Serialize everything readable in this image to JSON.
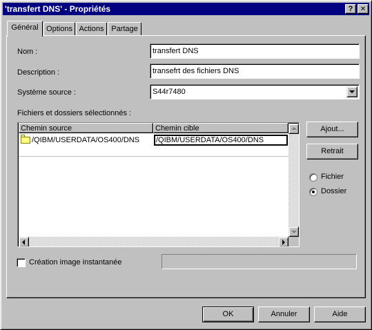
{
  "window": {
    "title": "'transfert DNS' - Propriétés",
    "help_glyph": "?",
    "close_glyph": "✕"
  },
  "tabs": [
    {
      "label": "Général",
      "active": true
    },
    {
      "label": "Options",
      "active": false
    },
    {
      "label": "Actions",
      "active": false
    },
    {
      "label": "Partage",
      "active": false
    }
  ],
  "form": {
    "name_label": "Nom :",
    "name_value": "transfert DNS",
    "description_label": "Description :",
    "description_value": "transefrt des fichiers DNS",
    "source_label": "Système source :",
    "source_value": "S44r7480",
    "files_label": "Fichiers et dossiers sélectionnés :"
  },
  "table": {
    "columns": [
      "Chemin source",
      "Chemin cible"
    ],
    "rows": [
      {
        "source": "/QIBM/USERDATA/OS400/DNS",
        "target": "/QIBM/USERDATA/OS400/DNS",
        "icon": "folder-icon"
      }
    ]
  },
  "side_buttons": {
    "add": "Ajout...",
    "remove": "Retrait"
  },
  "radio": {
    "file": "Fichier",
    "folder": "Dossier",
    "selected": "folder"
  },
  "snapshot": {
    "label": "Création image instantanée",
    "checked": false,
    "value": ""
  },
  "footer": {
    "ok": "OK",
    "cancel": "Annuler",
    "help": "Aide"
  },
  "colors": {
    "titlebar": "#000080",
    "face": "#c0c0c0",
    "folder": "#ffff80"
  }
}
